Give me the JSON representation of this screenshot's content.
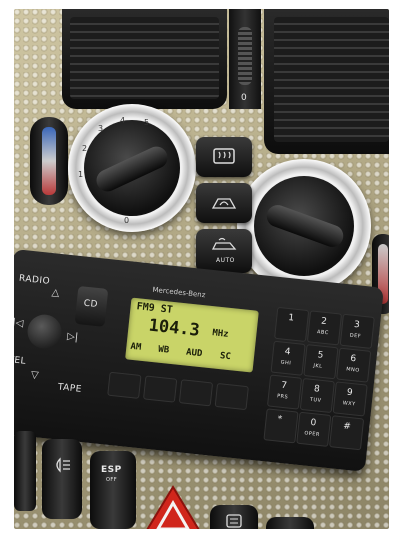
{
  "vents": {
    "wheel_label": "0"
  },
  "climate": {
    "left_knob_ticks": [
      "3",
      "4",
      "5",
      "2",
      "1",
      "0"
    ],
    "buttons": [
      {
        "name": "rear-defrost-button"
      },
      {
        "name": "recirculation-button"
      },
      {
        "name": "auto-button",
        "label": "AUTO"
      }
    ]
  },
  "radio": {
    "brand": "Mercedes-Benz",
    "buttons": {
      "radio": "RADIO",
      "cd": "CD",
      "tel": "TEL",
      "tape": "TAPE"
    },
    "display": {
      "line1": "FM9 ST",
      "line2_value": "104.3",
      "line2_unit": "MHz",
      "line3": [
        "AM",
        "WB",
        "AUD",
        "SC"
      ]
    },
    "keypad": [
      {
        "digit": "1",
        "letters": ""
      },
      {
        "digit": "2",
        "letters": "ABC"
      },
      {
        "digit": "3",
        "letters": "DEF"
      },
      {
        "digit": "4",
        "letters": "GHI"
      },
      {
        "digit": "5",
        "letters": "JKL"
      },
      {
        "digit": "6",
        "letters": "MNO"
      },
      {
        "digit": "7",
        "letters": "PRS"
      },
      {
        "digit": "8",
        "letters": "TUV"
      },
      {
        "digit": "9",
        "letters": "WXY"
      },
      {
        "digit": "*",
        "letters": ""
      },
      {
        "digit": "0",
        "letters": "OPER"
      },
      {
        "digit": "#",
        "letters": ""
      }
    ]
  },
  "bottom_switches": {
    "esp_label": "ESP",
    "esp_sub": "OFF"
  },
  "colors": {
    "lcd": "#c9d468",
    "panel": "#b9b08d",
    "black_trim": "#141414",
    "hazard": "#d0261c"
  }
}
